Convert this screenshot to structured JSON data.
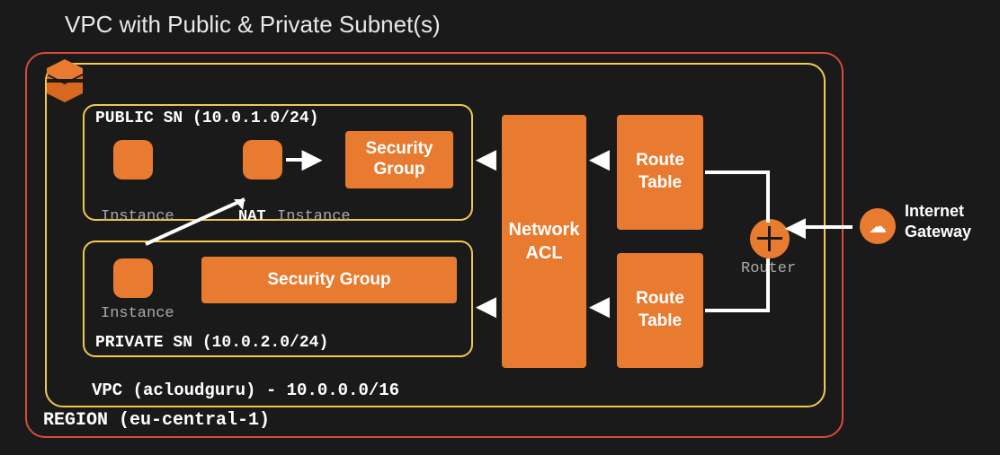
{
  "title": "VPC with Public & Private Subnet(s)",
  "region": {
    "label": "REGION (eu-central-1)"
  },
  "vpc": {
    "label": "VPC (acloudguru) - 10.0.0.0/16"
  },
  "public_sn": {
    "label": "PUBLIC SN (10.0.1.0/24)",
    "instance1_label": "Instance",
    "instance2_label": "Instance",
    "nat_label": "NAT",
    "sg_label": "Security Group"
  },
  "private_sn": {
    "label": "PRIVATE SN (10.0.2.0/24)",
    "instance_label": "Instance",
    "sg_label": "Security Group"
  },
  "nacl": {
    "label": "Network ACL"
  },
  "route_table1": {
    "label": "Route Table"
  },
  "route_table2": {
    "label": "Route Table"
  },
  "router": {
    "label": "Router"
  },
  "igw": {
    "label": "Internet Gateway"
  },
  "colors": {
    "orange": "#e87b2f",
    "yellow_border": "#f2c94c",
    "red_border": "#d94a3a",
    "bg": "#1a1a1a"
  }
}
